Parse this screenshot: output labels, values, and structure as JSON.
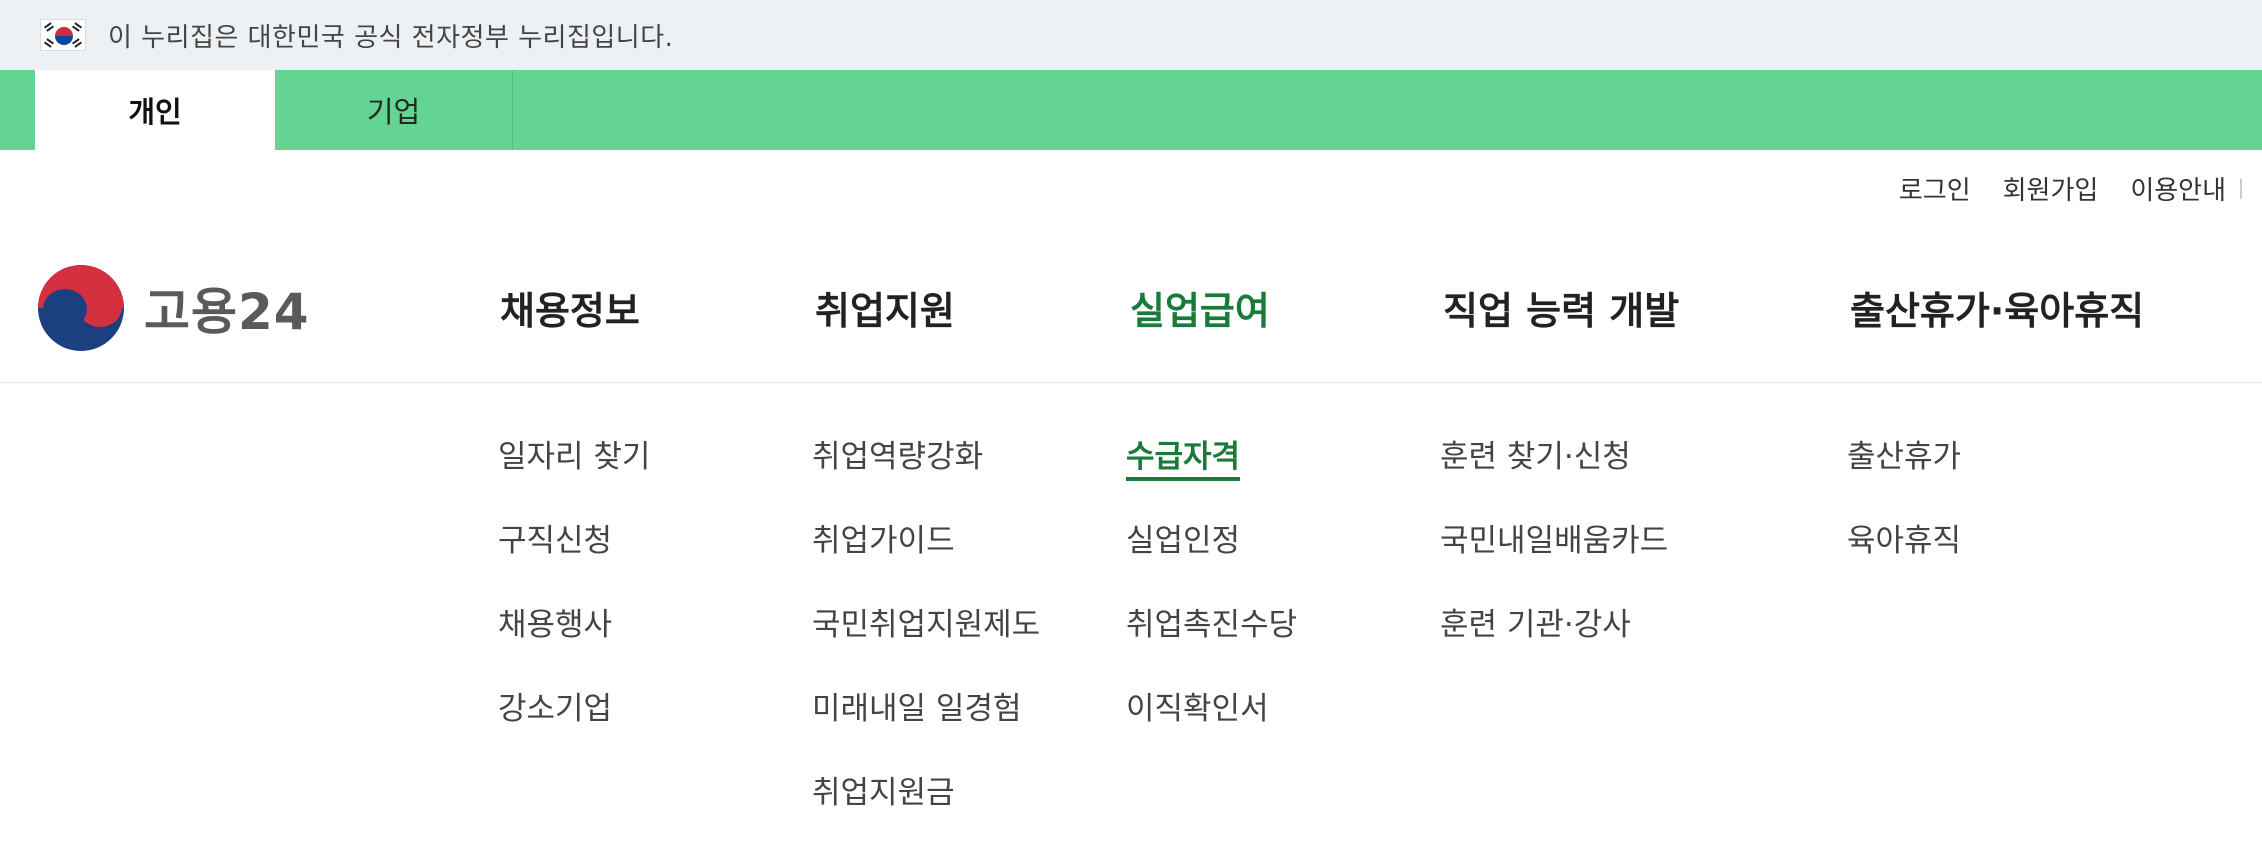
{
  "gov_banner": {
    "flag_icon": "korea-flag-icon",
    "text": "이 누리집은 대한민국 공식 전자정부 누리집입니다."
  },
  "tabs": [
    {
      "label": "개인",
      "active": true
    },
    {
      "label": "기업",
      "active": false
    }
  ],
  "util_links": {
    "login": "로그인",
    "signup": "회원가입",
    "guide": "이용안내"
  },
  "logo": {
    "icon": "government-symbol-icon",
    "text": "고용24"
  },
  "nav": {
    "items": [
      {
        "label": "채용정보"
      },
      {
        "label": "취업지원"
      },
      {
        "label": "실업급여",
        "active": true
      },
      {
        "label": "직업 능력 개발"
      },
      {
        "label": "출산휴가·육아휴직"
      }
    ]
  },
  "submenus": [
    {
      "items": [
        "일자리 찾기",
        "구직신청",
        "채용행사",
        "강소기업"
      ]
    },
    {
      "items": [
        "취업역량강화",
        "취업가이드",
        "국민취업지원제도",
        "미래내일 일경험",
        "취업지원금"
      ]
    },
    {
      "items": [
        "수급자격",
        "실업인정",
        "취업촉진수당",
        "이직확인서"
      ],
      "active_item": "수급자격"
    },
    {
      "items": [
        "훈련 찾기·신청",
        "국민내일배움카드",
        "훈련 기관·강사"
      ]
    },
    {
      "items": [
        "출산휴가",
        "육아휴직"
      ]
    }
  ],
  "colors": {
    "tab_bar_green": "#63d492",
    "active_green": "#1a7a3a",
    "banner_bg": "#eef1f4"
  }
}
